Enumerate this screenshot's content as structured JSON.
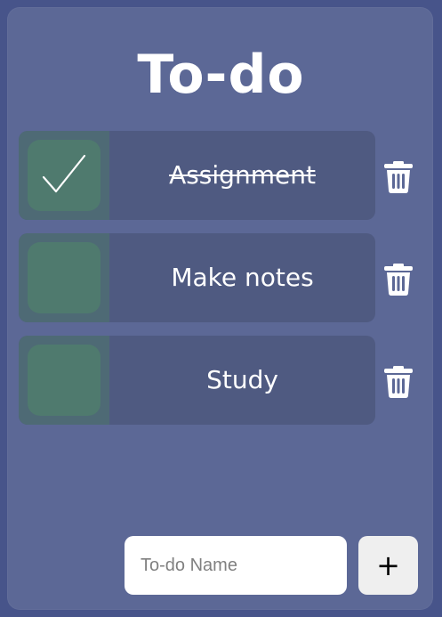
{
  "app": {
    "title": "To-do"
  },
  "todos": [
    {
      "label": "Assignment",
      "completed": true
    },
    {
      "label": "Make notes",
      "completed": false
    },
    {
      "label": "Study",
      "completed": false
    }
  ],
  "new_todo": {
    "placeholder": "To-do Name",
    "value": "",
    "add_label": "+"
  },
  "icons": {
    "check": "check-icon",
    "delete": "trash-icon"
  },
  "colors": {
    "page_bg": "#47548a",
    "card_bg": "#5c6896",
    "row_bg": "#4f5a81",
    "checkbox_bg": "#4f7a6e",
    "text": "#ffffff",
    "add_button_bg": "#efefef"
  }
}
